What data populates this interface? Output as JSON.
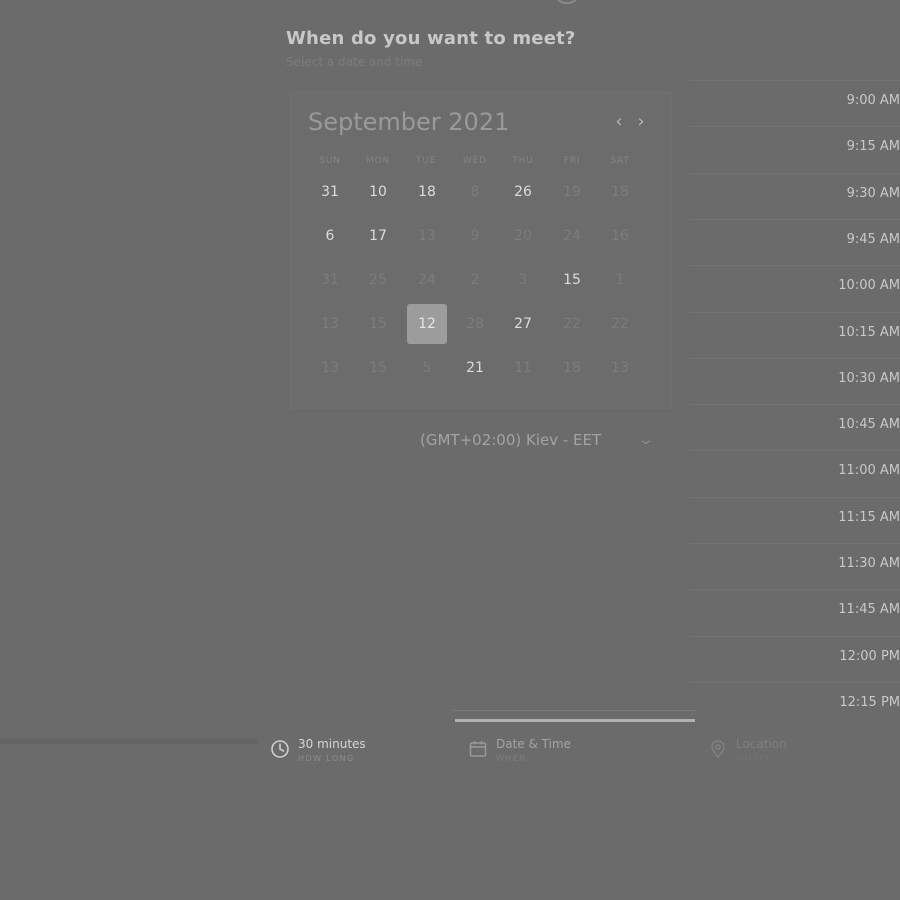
{
  "header": {
    "title": "When do you want to meet?",
    "subtitle": "Select a date and time"
  },
  "calendar": {
    "month_title": "September 2021",
    "prev_label": "‹",
    "next_label": "›",
    "weekdays": [
      "SUN",
      "MON",
      "TUE",
      "WED",
      "THU",
      "FRI",
      "SAT"
    ],
    "weeks": [
      [
        {
          "label": "31",
          "state": "active"
        },
        {
          "label": "10",
          "state": "active"
        },
        {
          "label": "18",
          "state": "active"
        },
        {
          "label": "8",
          "state": "disabled"
        },
        {
          "label": "26",
          "state": "active"
        },
        {
          "label": "19",
          "state": "disabled"
        },
        {
          "label": "18",
          "state": "disabled"
        }
      ],
      [
        {
          "label": "6",
          "state": "active"
        },
        {
          "label": "17",
          "state": "active"
        },
        {
          "label": "13",
          "state": "disabled"
        },
        {
          "label": "9",
          "state": "disabled"
        },
        {
          "label": "20",
          "state": "disabled"
        },
        {
          "label": "24",
          "state": "disabled"
        },
        {
          "label": "16",
          "state": "disabled"
        }
      ],
      [
        {
          "label": "31",
          "state": "disabled"
        },
        {
          "label": "25",
          "state": "disabled"
        },
        {
          "label": "24",
          "state": "disabled"
        },
        {
          "label": "2",
          "state": "disabled"
        },
        {
          "label": "3",
          "state": "disabled"
        },
        {
          "label": "15",
          "state": "active"
        },
        {
          "label": "1",
          "state": "disabled"
        }
      ],
      [
        {
          "label": "13",
          "state": "disabled"
        },
        {
          "label": "15",
          "state": "disabled"
        },
        {
          "label": "12",
          "state": "selected"
        },
        {
          "label": "28",
          "state": "disabled"
        },
        {
          "label": "27",
          "state": "active"
        },
        {
          "label": "22",
          "state": "disabled"
        },
        {
          "label": "22",
          "state": "disabled"
        }
      ],
      [
        {
          "label": "13",
          "state": "disabled"
        },
        {
          "label": "15",
          "state": "disabled"
        },
        {
          "label": "5",
          "state": "disabled"
        },
        {
          "label": "21",
          "state": "active"
        },
        {
          "label": "11",
          "state": "disabled"
        },
        {
          "label": "18",
          "state": "disabled"
        },
        {
          "label": "13",
          "state": "disabled"
        }
      ]
    ]
  },
  "timezone": {
    "value": "(GMT+02:00) Kiev - EET",
    "chevron": "⌄"
  },
  "time_slots": [
    "9:00 AM",
    "9:15 AM",
    "9:30 AM",
    "9:45 AM",
    "10:00 AM",
    "10:15 AM",
    "10:30 AM",
    "10:45 AM",
    "11:00 AM",
    "11:15 AM",
    "11:30 AM",
    "11:45 AM",
    "12:00 PM",
    "12:15 PM"
  ],
  "progress": {
    "fraction_complete": 0.5
  },
  "steps": [
    {
      "title": "30 minutes",
      "subtitle": "HOW LONG",
      "icon": "clock-icon"
    },
    {
      "title": "Date & Time",
      "subtitle": "WHEN",
      "icon": "calendar-icon"
    },
    {
      "title": "Location",
      "subtitle": "WHERE",
      "icon": "location-pin-icon"
    }
  ]
}
